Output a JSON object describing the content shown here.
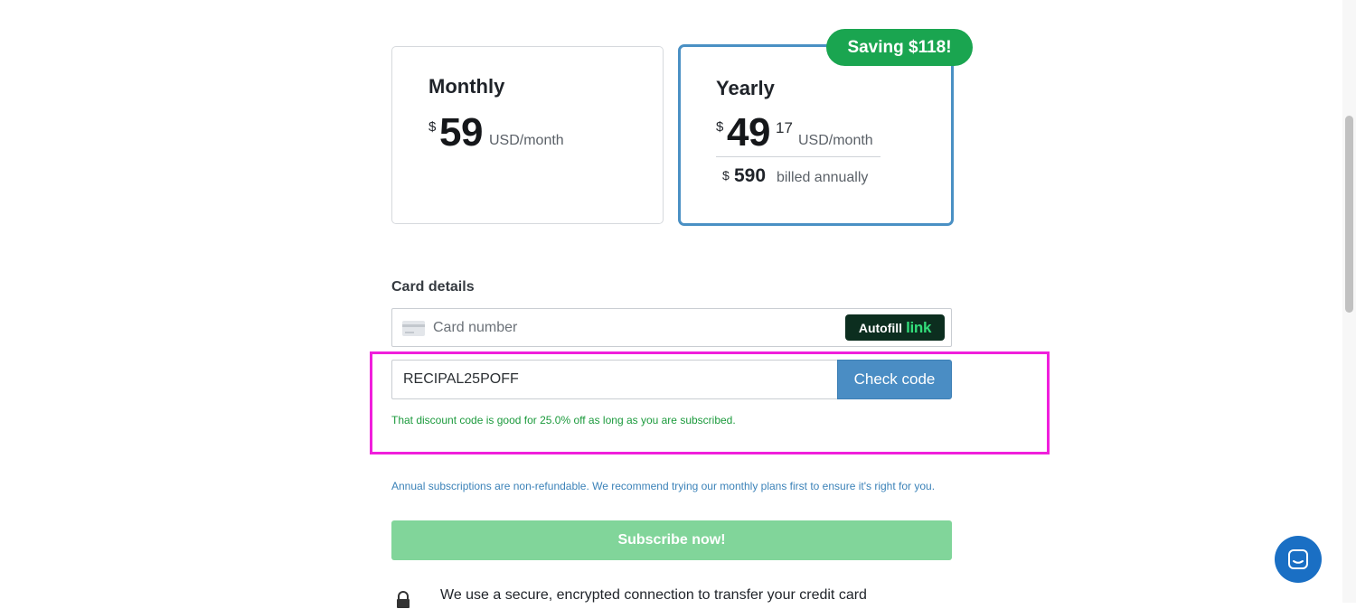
{
  "plans": {
    "monthly": {
      "title": "Monthly",
      "currency": "$",
      "price": "59",
      "unit": "USD/month"
    },
    "yearly": {
      "title": "Yearly",
      "currency": "$",
      "price": "49",
      "cents": "17",
      "unit": "USD/month",
      "annual_currency": "$",
      "annual_price": "590",
      "billed_label": "billed annually",
      "badge": "Saving $118!"
    }
  },
  "card": {
    "label": "Card details",
    "placeholder": "Card number",
    "autofill_label": "Autofill",
    "link_label": "link"
  },
  "discount": {
    "code": "RECIPAL25POFF",
    "button_label": "Check code",
    "message": "That discount code is good for 25.0% off as long as you are subscribed."
  },
  "refund_note": "Annual subscriptions are non-refundable. We recommend trying our monthly plans first to ensure it's right for you.",
  "subscribe_label": "Subscribe now!",
  "secure_text": "We use a secure, encrypted connection to transfer your credit card",
  "colors": {
    "accent": "#4a8dc4",
    "saving_badge": "#1aa550",
    "subscribe": "#81d59a",
    "success_text": "#1b9a3c",
    "highlight": "#f01fdc"
  },
  "icons": [
    "card-icon",
    "lock-icon",
    "chat-icon"
  ]
}
